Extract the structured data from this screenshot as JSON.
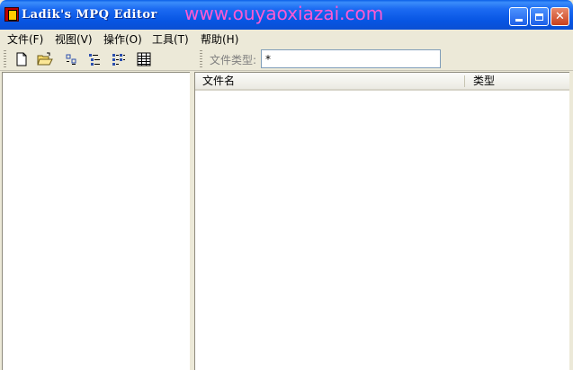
{
  "window": {
    "title": "Ladik's MPQ Editor",
    "watermark": "www.ouyaoxiazai.com"
  },
  "menu": {
    "items": [
      {
        "label": "文件(F)"
      },
      {
        "label": "视图(V)"
      },
      {
        "label": "操作(O)"
      },
      {
        "label": "工具(T)"
      },
      {
        "label": "帮助(H)"
      }
    ]
  },
  "toolbar": {
    "filetype_label": "文件类型:",
    "filetype_value": "*"
  },
  "list": {
    "columns": [
      {
        "label": "文件名"
      },
      {
        "label": "类型"
      }
    ]
  },
  "icons": {
    "new": "new-file-icon",
    "open": "open-folder-icon",
    "view1": "small-icons-view-icon",
    "view2": "tree-view-icon",
    "view3": "list-view-icon",
    "view4": "details-view-icon"
  }
}
